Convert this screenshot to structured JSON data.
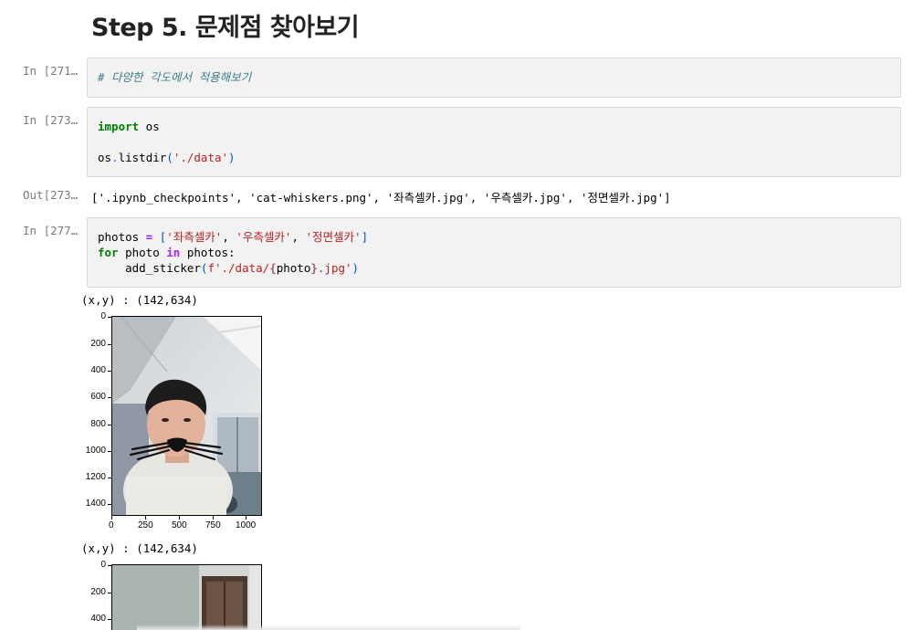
{
  "heading": "Step 5. 문제점 찾아보기",
  "cells": [
    {
      "prompt": "In [271…",
      "comment": "# 다양한 각도에서 적용해보기"
    },
    {
      "prompt": "In [273…",
      "import_kw": "import",
      "import_mod": " os",
      "line2_obj": "os",
      "line2_dot": ".",
      "line2_fn": "listdir",
      "line2_open": "(",
      "line2_str": "'./data'",
      "line2_close": ")",
      "out_prompt": "Out[273…",
      "output": "['.ipynb_checkpoints', 'cat-whiskers.png', '좌측셀카.jpg', '우측셀카.jpg', '정면셀카.jpg']"
    },
    {
      "prompt": "In [277…",
      "l1_var": "photos ",
      "l1_eq": "=",
      "l1_open": " [",
      "l1_s1": "'좌측셀카'",
      "l1_c1": ", ",
      "l1_s2": "'우측셀카'",
      "l1_c2": ", ",
      "l1_s3": "'정면셀카'",
      "l1_close": "]",
      "l2_for": "for",
      "l2_var": " photo ",
      "l2_in": "in",
      "l2_rest": " photos:",
      "l3_indent": "    ",
      "l3_fn": "add_sticker",
      "l3_open": "(",
      "l3_f": "f",
      "l3_s": "'./data/",
      "l3_brace1": "{",
      "l3_photo": "photo",
      "l3_brace2": "}",
      "l3_s2": ".jpg'",
      "l3_close": ")"
    }
  ],
  "outputs": [
    {
      "coords": "(x,y) : (142,634)",
      "yticks": [
        "0",
        "200",
        "400",
        "600",
        "800",
        "1000",
        "1200",
        "1400"
      ],
      "xticks": [
        "0",
        "250",
        "500",
        "750",
        "1000"
      ]
    },
    {
      "coords": "(x,y) : (142,634)",
      "yticks": [
        "0",
        "200",
        "400"
      ]
    }
  ],
  "colors": {
    "cell_bg": "#f2f2f2",
    "prompt": "#7a7a7a",
    "keyword": "#008000",
    "string": "#ba2121",
    "comment": "#3d7d8a"
  }
}
